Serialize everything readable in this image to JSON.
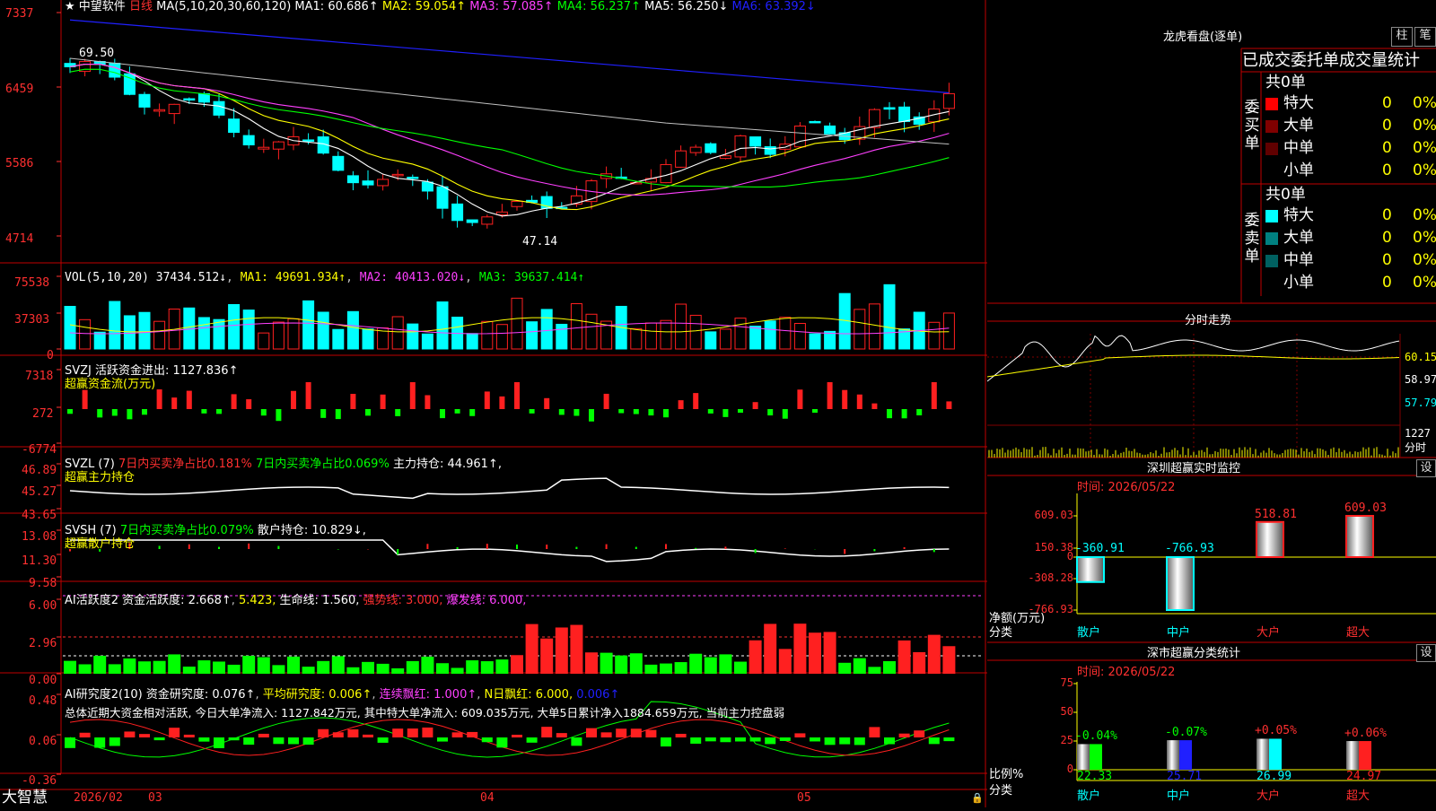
{
  "colors": {
    "up": "#ff2020",
    "down": "#00ffff",
    "green": "#00ff00",
    "yellow": "#ffff00",
    "magenta": "#ff40ff",
    "blue": "#1010ff",
    "white": "#ffffff",
    "axis": "#ff3030"
  },
  "kline": {
    "star": "★",
    "name": "中望软件",
    "period": "日线",
    "ma_params": "MA(5,10,20,30,60,120)",
    "ma1": "MA1: 60.686↑",
    "ma2": "MA2: 59.054↑",
    "ma3": "MA3: 57.085↑",
    "ma4": "MA4: 56.237↑",
    "ma5": "MA5: 56.250↓",
    "ma6": "MA6: 63.392↓",
    "y_ticks": [
      "7337",
      "6459",
      "5586",
      "4714"
    ],
    "high_label": "69.50",
    "low_label": "47.14"
  },
  "vol": {
    "title": "VOL(5,10,20)",
    "value": "37434.512↓",
    "ma1": "MA1: 49691.934↑",
    "ma2": "MA2: 40413.020↓",
    "ma3": "MA3: 39637.414↑",
    "y_ticks": [
      "75538",
      "37303",
      "0"
    ]
  },
  "svzj": {
    "title": "SVZJ",
    "desc": "活跃资金进出: 1127.836↑",
    "sub": "超赢资金流(万元)",
    "y_ticks": [
      "7318",
      "272",
      "-6774"
    ]
  },
  "svzl": {
    "title": "SVZL (7)",
    "a": "7日内买卖净占比0.181%",
    "b": "7日内买卖净占比0.069%",
    "c": "主力持仓: 44.961↑,",
    "sub": "超赢主力持仓",
    "y_ticks": [
      "46.89",
      "45.27",
      "43.65"
    ]
  },
  "svsh": {
    "title": "SVSH (7)",
    "a": "7日内买卖净占比0.079%",
    "b": "散户持仓: 10.829↓,",
    "sub": "超赢散户持仓",
    "y_ticks": [
      "13.08",
      "11.30",
      "9.58"
    ]
  },
  "ai1": {
    "title": "AI活跃度2",
    "a": "资金活跃度: 2.668↑",
    "b": "5.423,",
    "c": "生命线: 1.560,",
    "d": "强势线: 3.000,",
    "e": "爆发线: 6.000,",
    "y_ticks": [
      "6.00",
      "2.96",
      "0.00"
    ]
  },
  "ai2": {
    "title": "AI研究度2(10)",
    "a": "资金研究度: 0.076↑",
    "b": "平均研究度: 0.006↑",
    "c": "连续飘红: 1.000↑",
    "d": "N日飘红: 6.000,",
    "e": "0.006↑",
    "summary": "总体近期大资金相对活跃, 今日大单净流入: 1127.842万元, 其中特大单净流入: 609.035万元, 大单5日累计净入1884.659万元, 当前主力控盘弱",
    "y_ticks": [
      "0.48",
      "0.06",
      "-0.36"
    ]
  },
  "bottom": {
    "brand": "大智慧",
    "dates": [
      "2026/02",
      "03",
      "04",
      "05"
    ]
  },
  "dragon": {
    "title": "龙虎看盘(逐单)",
    "btn_a": "柱",
    "btn_b": "笔",
    "tab_a": "已成交",
    "tab_b": "委托单",
    "tab_c": "成交量统计",
    "buy_label": "委买单",
    "sell_label": "委卖单",
    "buy_total": "共0单",
    "sell_total": "共0单",
    "rows": [
      {
        "label": "特大",
        "n": "0",
        "p": "0%"
      },
      {
        "label": "大单",
        "n": "0",
        "p": "0%"
      },
      {
        "label": "中单",
        "n": "0",
        "p": "0%"
      },
      {
        "label": "小单",
        "n": "0",
        "p": "0%"
      }
    ]
  },
  "intraday": {
    "title": "分时走势",
    "y_ticks": [
      "60.15",
      "58.97",
      "57.79"
    ],
    "vol_a": "1227",
    "vol_b": "分时"
  },
  "monitor": {
    "title": "深圳超赢实时监控",
    "btn": "设",
    "time": "时间: 2026/05/22",
    "y_ticks": [
      "609.03",
      "150.38",
      "0",
      "-308.28",
      "-766.93"
    ],
    "ylabel": "净额(万元)",
    "xlabel": "分类",
    "categories": [
      "散户",
      "中户",
      "大户",
      "超大"
    ],
    "values": [
      "-360.91",
      "-766.93",
      "518.81",
      "609.03"
    ]
  },
  "stats": {
    "title": "深市超赢分类统计",
    "btn": "设",
    "time": "时间: 2026/05/22",
    "y_ticks": [
      "75",
      "50",
      "25",
      "0"
    ],
    "ylabel": "比例%",
    "xlabel": "分类",
    "categories": [
      "散户",
      "中户",
      "大户",
      "超大"
    ],
    "top": [
      "-0.04%",
      "-0.07%",
      "+0.05%",
      "+0.06%"
    ],
    "values": [
      "22.33",
      "25.71",
      "26.99",
      "24.97"
    ]
  },
  "chart_data": [
    {
      "type": "bar",
      "title": "深圳超赢实时监控",
      "ylabel": "净额(万元)",
      "xlabel": "分类",
      "categories": [
        "散户",
        "中户",
        "大户",
        "超大"
      ],
      "values": [
        -360.91,
        -766.93,
        518.81,
        609.03
      ],
      "ylim": [
        -766.93,
        609.03
      ]
    },
    {
      "type": "bar",
      "title": "深市超赢分类统计",
      "ylabel": "比例%",
      "xlabel": "分类",
      "categories": [
        "散户",
        "中户",
        "大户",
        "超大"
      ],
      "values": [
        22.33,
        25.71,
        26.99,
        24.97
      ],
      "ylim": [
        0,
        75
      ]
    }
  ]
}
